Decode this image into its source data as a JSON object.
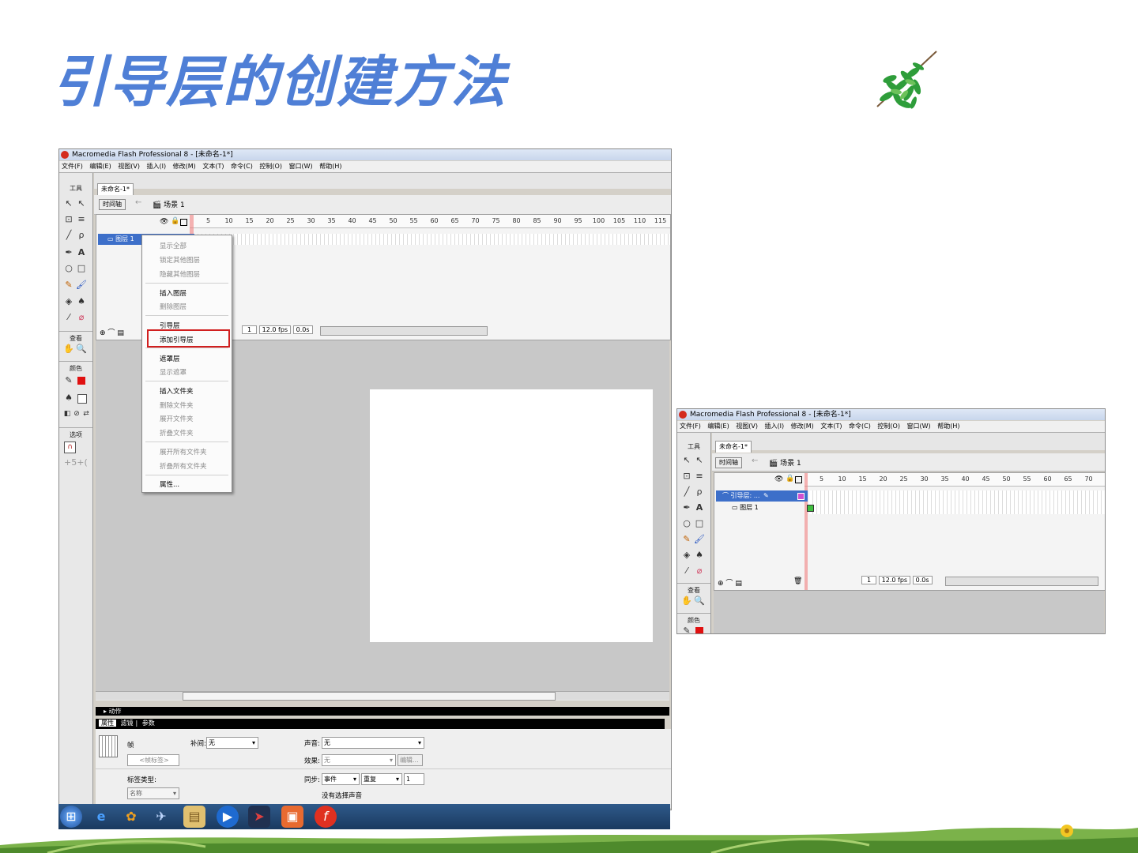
{
  "slide": {
    "title": "引导层的创建方法"
  },
  "left_window": {
    "title": "Macromedia Flash Professional 8 - [未命名-1*]",
    "menu": [
      "文件(F)",
      "编辑(E)",
      "视图(V)",
      "插入(I)",
      "修改(M)",
      "文本(T)",
      "命令(C)",
      "控制(O)",
      "窗口(W)",
      "帮助(H)"
    ],
    "toolbox": {
      "tools_label": "工具",
      "view_label": "查看",
      "color_label": "颜色",
      "options_label": "选项"
    },
    "doc_tab": "未命名-1*",
    "timeline_button": "时间轴",
    "scene": "场景 1",
    "ruler": [
      "5",
      "10",
      "15",
      "20",
      "25",
      "30",
      "35",
      "40",
      "45",
      "50",
      "55",
      "60",
      "65",
      "70",
      "75",
      "80",
      "85",
      "90",
      "95",
      "100",
      "105",
      "110",
      "115"
    ],
    "layer_name": "图层 1",
    "status": {
      "frame": "1",
      "fps": "12.0 fps",
      "time": "0.0s"
    },
    "context_menu": {
      "items": [
        {
          "label": "显示全部",
          "enabled": false
        },
        {
          "label": "锁定其他图层",
          "enabled": false
        },
        {
          "label": "隐藏其他图层",
          "enabled": false
        },
        {
          "label": "插入图层",
          "enabled": true
        },
        {
          "label": "删除图层",
          "enabled": false
        },
        {
          "label": "引导层",
          "enabled": true
        },
        {
          "label": "添加引导层",
          "enabled": true,
          "highlighted": true
        },
        {
          "label": "遮罩层",
          "enabled": true
        },
        {
          "label": "显示遮罩",
          "enabled": false
        },
        {
          "label": "插入文件夹",
          "enabled": true
        },
        {
          "label": "删除文件夹",
          "enabled": false
        },
        {
          "label": "展开文件夹",
          "enabled": false
        },
        {
          "label": "折叠文件夹",
          "enabled": false
        },
        {
          "label": "展开所有文件夹",
          "enabled": false
        },
        {
          "label": "折叠所有文件夹",
          "enabled": false
        },
        {
          "label": "属性...",
          "enabled": true
        }
      ],
      "highlight_color": "#d11f1f"
    },
    "actions_bar": "▸ 动作",
    "props_tabs": [
      "属性",
      "滤镜",
      "参数"
    ],
    "properties": {
      "frame_label": "帧",
      "frame_name_placeholder": "<帧标签>",
      "tween_label": "补间:",
      "tween_value": "无",
      "sound_label": "声音:",
      "sound_value": "无",
      "effect_label": "效果:",
      "effect_value": "无",
      "edit_button": "编辑...",
      "label_type": "标签类型:",
      "label_type_value": "名称",
      "sync_label": "同步:",
      "sync_value": "事件",
      "repeat_value": "重复",
      "repeat_count": "1",
      "no_sound": "没有选择声音"
    }
  },
  "right_window": {
    "title": "Macromedia Flash Professional 8 - [未命名-1*]",
    "menu": [
      "文件(F)",
      "编辑(E)",
      "视图(V)",
      "插入(I)",
      "修改(M)",
      "文本(T)",
      "命令(C)",
      "控制(O)",
      "窗口(W)",
      "帮助(H)"
    ],
    "toolbox": {
      "tools_label": "工具",
      "view_label": "查看",
      "color_label": "颜色"
    },
    "doc_tab": "未命名-1*",
    "timeline_button": "时间轴",
    "scene": "场景 1",
    "ruler": [
      "5",
      "10",
      "15",
      "20",
      "25",
      "30",
      "35",
      "40",
      "45",
      "50",
      "55",
      "60",
      "65",
      "70"
    ],
    "layers": [
      {
        "name": "引导层: ...",
        "selected": true
      },
      {
        "name": "图层 1",
        "selected": false
      }
    ],
    "status": {
      "frame": "1",
      "fps": "12.0 fps",
      "time": "0.0s"
    }
  },
  "taskbar": {
    "icons": [
      "start-orb-icon",
      "ie-icon",
      "media-icon",
      "bird-icon",
      "folder-icon",
      "player-icon",
      "flash-arrow-icon",
      "powerpoint-icon",
      "flash-icon"
    ]
  },
  "colors": {
    "title": "#4f7fd6",
    "selected_layer": "#3d6fc9"
  }
}
